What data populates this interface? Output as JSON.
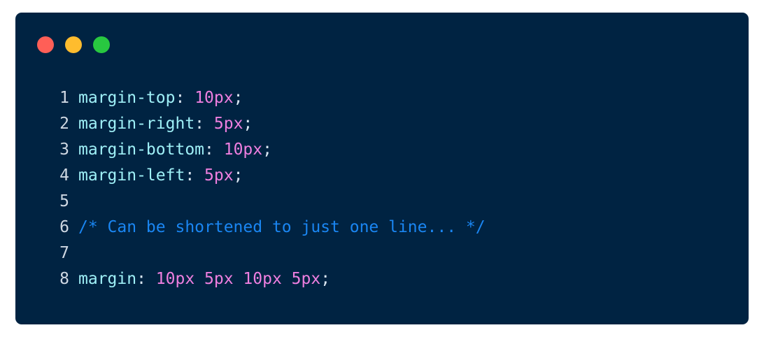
{
  "window": {
    "background": "#002342",
    "controls": [
      {
        "name": "close",
        "color": "#ff5f57"
      },
      {
        "name": "minimize",
        "color": "#febc2e"
      },
      {
        "name": "zoom",
        "color": "#28c840"
      }
    ]
  },
  "colors": {
    "property": "#9ff0f7",
    "value": "#ef7fe0",
    "comment": "#1a86f2",
    "punctuation": "#d9e6f2",
    "line_number": "#cfd8e3"
  },
  "code": {
    "lines": [
      {
        "num": "1",
        "tokens": [
          {
            "type": "prop",
            "text": "margin-top"
          },
          {
            "type": "punc",
            "text": ": "
          },
          {
            "type": "val",
            "text": "10px"
          },
          {
            "type": "punc",
            "text": ";"
          }
        ]
      },
      {
        "num": "2",
        "tokens": [
          {
            "type": "prop",
            "text": "margin-right"
          },
          {
            "type": "punc",
            "text": ": "
          },
          {
            "type": "val",
            "text": "5px"
          },
          {
            "type": "punc",
            "text": ";"
          }
        ]
      },
      {
        "num": "3",
        "tokens": [
          {
            "type": "prop",
            "text": "margin-bottom"
          },
          {
            "type": "punc",
            "text": ": "
          },
          {
            "type": "val",
            "text": "10px"
          },
          {
            "type": "punc",
            "text": ";"
          }
        ]
      },
      {
        "num": "4",
        "tokens": [
          {
            "type": "prop",
            "text": "margin-left"
          },
          {
            "type": "punc",
            "text": ": "
          },
          {
            "type": "val",
            "text": "5px"
          },
          {
            "type": "punc",
            "text": ";"
          }
        ]
      },
      {
        "num": "5",
        "tokens": []
      },
      {
        "num": "6",
        "tokens": [
          {
            "type": "com",
            "text": "/* Can be shortened to just one line... */"
          }
        ]
      },
      {
        "num": "7",
        "tokens": []
      },
      {
        "num": "8",
        "tokens": [
          {
            "type": "prop",
            "text": "margin"
          },
          {
            "type": "punc",
            "text": ": "
          },
          {
            "type": "val",
            "text": "10px 5px 10px 5px"
          },
          {
            "type": "punc",
            "text": ";"
          }
        ]
      }
    ]
  }
}
